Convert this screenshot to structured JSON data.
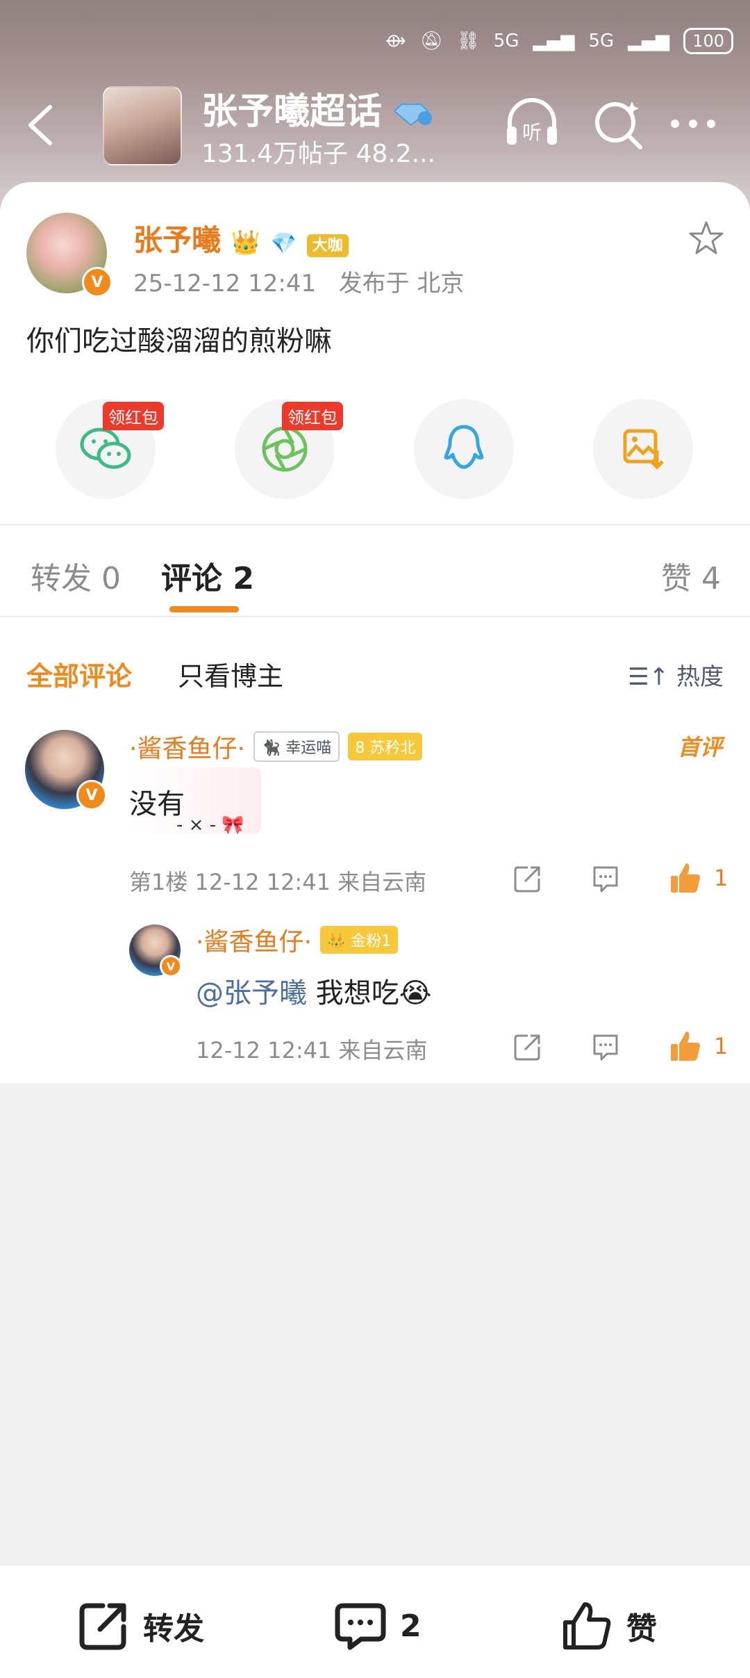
{
  "status_bar": {
    "network_1": "5G",
    "network_2": "5G",
    "battery": "100"
  },
  "header": {
    "title": "张予曦超话",
    "subtitle": "131.4万帖子 48.2...",
    "listen_label": "听"
  },
  "post": {
    "author": "张予曦",
    "author_tag": "大咖",
    "time": "25-12-12 12:41",
    "location": "发布于 北京",
    "text": "你们吃过酸溜溜的煎粉嘛"
  },
  "share": {
    "wechat_tag": "领红包",
    "moments_tag": "领红包"
  },
  "tabs": [
    {
      "label": "转发 0"
    },
    {
      "label": "评论 2"
    },
    {
      "label": "赞 4"
    }
  ],
  "filters": {
    "all": "全部评论",
    "blogger_only": "只看博主",
    "sort": "热度"
  },
  "comments": [
    {
      "name": "·酱香鱼仔·",
      "badge1": "幸运喵",
      "badge2": "苏矜北",
      "badge2_level": "8",
      "first_label": "首评",
      "text": "没有",
      "decor": "- × -",
      "floor": "第1楼",
      "time": "12-12 12:41",
      "from": "来自云南",
      "likes": "1"
    },
    {
      "name": "·酱香鱼仔·",
      "badge1": "金粉1",
      "mention": "@张予曦",
      "text": "我想吃😭",
      "time": "12-12 12:41",
      "from": "来自云南",
      "likes": "1"
    }
  ],
  "bottom_bar": {
    "repost": "转发",
    "comment_count": "2",
    "like": "赞"
  },
  "colors": {
    "accent": "#f08a1b",
    "name": "#eb7b1a",
    "link": "#4a6fa5"
  }
}
